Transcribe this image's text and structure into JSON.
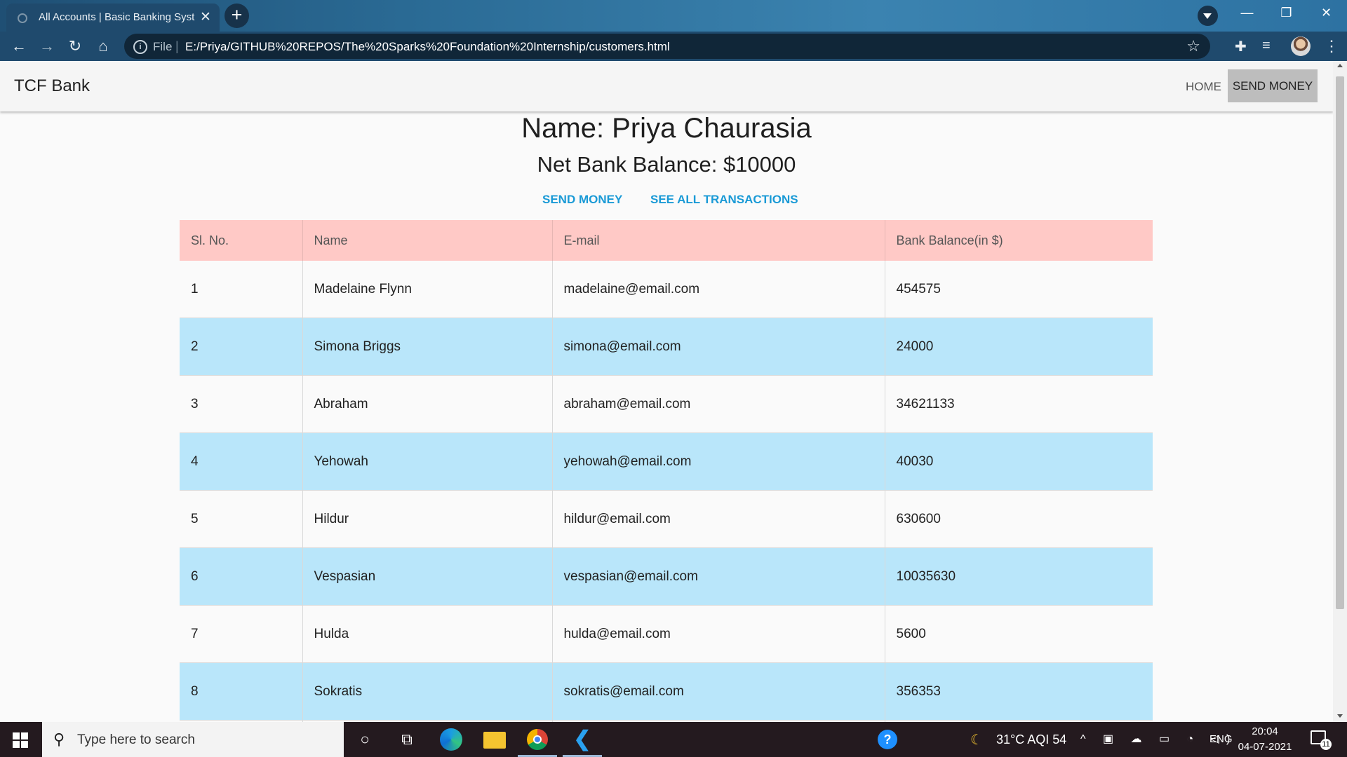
{
  "browser": {
    "tab_title": "All Accounts | Basic Banking Syst",
    "tab_close": "✕",
    "new_tab": "+",
    "url_scheme": "File",
    "url_path": "E:/Priya/GITHUB%20REPOS/The%20Sparks%20Foundation%20Internship/customers.html",
    "window_controls": {
      "minimize": "—",
      "maximize": "❐",
      "close": "✕"
    },
    "nav_icons": {
      "back": "←",
      "forward": "→",
      "reload": "↻",
      "home": "⌂",
      "star": "☆",
      "extensions": "✚",
      "media": "≡",
      "menu": "⋮"
    }
  },
  "navbar": {
    "brand": "TCF Bank",
    "home_label": "HOME",
    "send_money_label": "SEND MONEY"
  },
  "account": {
    "name_line": "Name: Priya Chaurasia",
    "balance_line": "Net Bank Balance: $10000",
    "send_money_link": "SEND MONEY",
    "transactions_link": "SEE ALL TRANSACTIONS"
  },
  "table": {
    "headers": [
      "Sl. No.",
      "Name",
      "E-mail",
      "Bank Balance(in $)"
    ],
    "rows": [
      [
        "1",
        "Madelaine Flynn",
        "madelaine@email.com",
        "454575"
      ],
      [
        "2",
        "Simona Briggs",
        "simona@email.com",
        "24000"
      ],
      [
        "3",
        "Abraham",
        "abraham@email.com",
        "34621133"
      ],
      [
        "4",
        "Yehowah",
        "yehowah@email.com",
        "40030"
      ],
      [
        "5",
        "Hildur",
        "hildur@email.com",
        "630600"
      ],
      [
        "6",
        "Vespasian",
        "vespasian@email.com",
        "10035630"
      ],
      [
        "7",
        "Hulda",
        "hulda@email.com",
        "5600"
      ],
      [
        "8",
        "Sokratis",
        "sokratis@email.com",
        "356353"
      ],
      [
        "",
        "",
        "",
        ""
      ]
    ]
  },
  "taskbar": {
    "search_placeholder": "Type here to search",
    "weather": "31°C  AQI 54",
    "language": "ENG",
    "time": "20:04",
    "date": "04-07-2021",
    "notification_count": "11",
    "help_glyph": "?",
    "cortana_glyph": "○",
    "taskview_glyph": "⧉",
    "vscode_glyph": "❮",
    "tray_glyphs": "^ ▣ ☁ ▭ ◔ ◁)",
    "moon_glyph": "☾",
    "search_glyph": "⚲"
  },
  "colors": {
    "table_header_bg": "#ffc9c6",
    "row_alt_bg": "#b9e6fa",
    "link_color": "#1a9ad6",
    "nav_active_bg": "#bdbdbd"
  }
}
